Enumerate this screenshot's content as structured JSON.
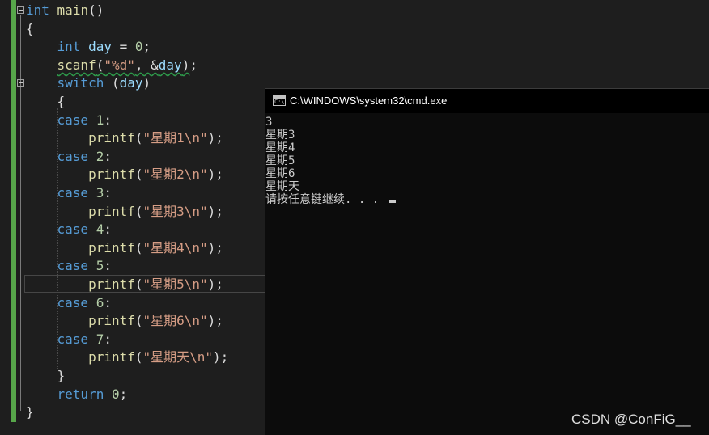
{
  "editor": {
    "lines": [
      [
        {
          "c": "kw",
          "t": "int"
        },
        {
          "c": "",
          "t": " "
        },
        {
          "c": "fn",
          "t": "main"
        },
        {
          "c": "",
          "t": "()"
        }
      ],
      [
        {
          "c": "",
          "t": "{"
        }
      ],
      [
        {
          "c": "",
          "t": "    "
        },
        {
          "c": "kw",
          "t": "int"
        },
        {
          "c": "",
          "t": " "
        },
        {
          "c": "var",
          "t": "day"
        },
        {
          "c": "",
          "t": " = "
        },
        {
          "c": "num",
          "t": "0"
        },
        {
          "c": "",
          "t": ";"
        }
      ],
      [
        {
          "c": "",
          "t": "    "
        },
        {
          "c": "fn squig",
          "t": "scanf"
        },
        {
          "c": "squig",
          "t": "("
        },
        {
          "c": "str squig",
          "t": "\"%d\""
        },
        {
          "c": "squig",
          "t": ", &"
        },
        {
          "c": "var squig",
          "t": "day"
        },
        {
          "c": "squig",
          "t": ")"
        },
        {
          "c": "",
          "t": ";"
        }
      ],
      [
        {
          "c": "",
          "t": "    "
        },
        {
          "c": "kw",
          "t": "switch"
        },
        {
          "c": "",
          "t": " ("
        },
        {
          "c": "var",
          "t": "day"
        },
        {
          "c": "",
          "t": ")"
        }
      ],
      [
        {
          "c": "",
          "t": "    {"
        }
      ],
      [
        {
          "c": "",
          "t": "    "
        },
        {
          "c": "kw",
          "t": "case"
        },
        {
          "c": "",
          "t": " "
        },
        {
          "c": "num",
          "t": "1"
        },
        {
          "c": "",
          "t": ":"
        }
      ],
      [
        {
          "c": "",
          "t": "        "
        },
        {
          "c": "fn",
          "t": "printf"
        },
        {
          "c": "",
          "t": "("
        },
        {
          "c": "str",
          "t": "\"星期1\\n\""
        },
        {
          "c": "",
          "t": ");"
        }
      ],
      [
        {
          "c": "",
          "t": "    "
        },
        {
          "c": "kw",
          "t": "case"
        },
        {
          "c": "",
          "t": " "
        },
        {
          "c": "num",
          "t": "2"
        },
        {
          "c": "",
          "t": ":"
        }
      ],
      [
        {
          "c": "",
          "t": "        "
        },
        {
          "c": "fn",
          "t": "printf"
        },
        {
          "c": "",
          "t": "("
        },
        {
          "c": "str",
          "t": "\"星期2\\n\""
        },
        {
          "c": "",
          "t": ");"
        }
      ],
      [
        {
          "c": "",
          "t": "    "
        },
        {
          "c": "kw",
          "t": "case"
        },
        {
          "c": "",
          "t": " "
        },
        {
          "c": "num",
          "t": "3"
        },
        {
          "c": "",
          "t": ":"
        }
      ],
      [
        {
          "c": "",
          "t": "        "
        },
        {
          "c": "fn",
          "t": "printf"
        },
        {
          "c": "",
          "t": "("
        },
        {
          "c": "str",
          "t": "\"星期3\\n\""
        },
        {
          "c": "",
          "t": ");"
        }
      ],
      [
        {
          "c": "",
          "t": "    "
        },
        {
          "c": "kw",
          "t": "case"
        },
        {
          "c": "",
          "t": " "
        },
        {
          "c": "num",
          "t": "4"
        },
        {
          "c": "",
          "t": ":"
        }
      ],
      [
        {
          "c": "",
          "t": "        "
        },
        {
          "c": "fn",
          "t": "printf"
        },
        {
          "c": "",
          "t": "("
        },
        {
          "c": "str",
          "t": "\"星期4\\n\""
        },
        {
          "c": "",
          "t": ");"
        }
      ],
      [
        {
          "c": "",
          "t": "    "
        },
        {
          "c": "kw",
          "t": "case"
        },
        {
          "c": "",
          "t": " "
        },
        {
          "c": "num",
          "t": "5"
        },
        {
          "c": "",
          "t": ":"
        }
      ],
      [
        {
          "c": "",
          "t": "        "
        },
        {
          "c": "fn",
          "t": "printf"
        },
        {
          "c": "",
          "t": "("
        },
        {
          "c": "str",
          "t": "\"星期5\\n\""
        },
        {
          "c": "",
          "t": ");"
        }
      ],
      [
        {
          "c": "",
          "t": "    "
        },
        {
          "c": "kw",
          "t": "case"
        },
        {
          "c": "",
          "t": " "
        },
        {
          "c": "num",
          "t": "6"
        },
        {
          "c": "",
          "t": ":"
        }
      ],
      [
        {
          "c": "",
          "t": "        "
        },
        {
          "c": "fn",
          "t": "printf"
        },
        {
          "c": "",
          "t": "("
        },
        {
          "c": "str",
          "t": "\"星期6\\n\""
        },
        {
          "c": "",
          "t": ");"
        }
      ],
      [
        {
          "c": "",
          "t": "    "
        },
        {
          "c": "kw",
          "t": "case"
        },
        {
          "c": "",
          "t": " "
        },
        {
          "c": "num",
          "t": "7"
        },
        {
          "c": "",
          "t": ":"
        }
      ],
      [
        {
          "c": "",
          "t": "        "
        },
        {
          "c": "fn",
          "t": "printf"
        },
        {
          "c": "",
          "t": "("
        },
        {
          "c": "str",
          "t": "\"星期天\\n\""
        },
        {
          "c": "",
          "t": ");"
        }
      ],
      [
        {
          "c": "",
          "t": "    }"
        }
      ],
      [
        {
          "c": "",
          "t": "    "
        },
        {
          "c": "kw",
          "t": "return"
        },
        {
          "c": "",
          "t": " "
        },
        {
          "c": "num",
          "t": "0"
        },
        {
          "c": "",
          "t": ";"
        }
      ],
      [
        {
          "c": "",
          "t": "}"
        }
      ]
    ],
    "colors": {
      "keyword": "#569cd6",
      "variable": "#9cdcfe",
      "function": "#dcdcaa",
      "string": "#d69d85",
      "number": "#b5cea8",
      "change_bar": "#57a64a"
    }
  },
  "console": {
    "title": "C:\\WINDOWS\\system32\\cmd.exe",
    "icon": "cmd-window-icon",
    "icon_text": "C:\\",
    "output": [
      "3",
      "星期3",
      "星期4",
      "星期5",
      "星期6",
      "星期天",
      "请按任意键继续. . . "
    ]
  },
  "watermark": "CSDN @ConFiG__"
}
